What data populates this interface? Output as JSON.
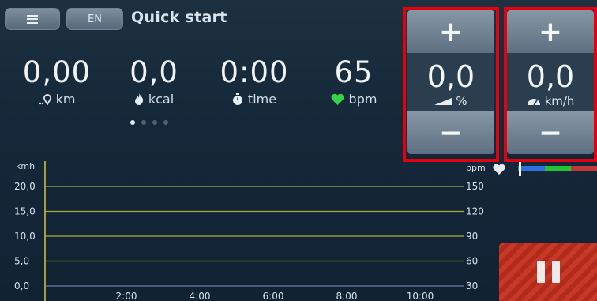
{
  "header": {
    "language": "EN",
    "mode_title": "Quick start"
  },
  "stats": [
    {
      "value": "0,00",
      "unit": "km",
      "icon": "distance-pin-icon"
    },
    {
      "value": "0,0",
      "unit": "kcal",
      "icon": "flame-icon"
    },
    {
      "value": "0:00",
      "unit": "time",
      "icon": "stopwatch-icon"
    },
    {
      "value": "65",
      "unit": "bpm",
      "icon": "heart-icon"
    }
  ],
  "page_indicator": {
    "pages": 4,
    "current": 1
  },
  "incline": {
    "plus": "+",
    "value": "0,0",
    "unit": "%",
    "minus": "−"
  },
  "speed": {
    "plus": "+",
    "value": "0,0",
    "unit": "km/h",
    "minus": "−"
  },
  "chart_data": {
    "type": "line",
    "left_axis_label": "kmh",
    "right_axis_label": "bpm",
    "left_ticks": [
      "0,0",
      "5,0",
      "10,0",
      "15,0",
      "20,0"
    ],
    "right_ticks": [
      "30",
      "60",
      "90",
      "120",
      "150"
    ],
    "x_ticks": [
      "2:00",
      "4:00",
      "6:00",
      "8:00",
      "10:00"
    ],
    "left_ylim": [
      0,
      20
    ],
    "right_ylim": [
      30,
      150
    ],
    "series": [],
    "grid": true
  },
  "hr_zones": {
    "colors": [
      "#2f6fe0",
      "#22c433",
      "#c3373a"
    ]
  },
  "colors": {
    "accent_red": "#e3000f",
    "heart_green": "#35d24a",
    "grid": "#c9c03a"
  }
}
